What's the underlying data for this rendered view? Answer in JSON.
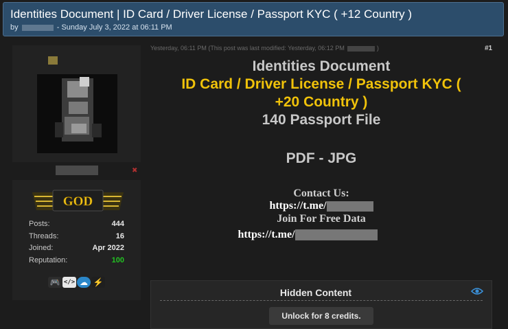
{
  "thread": {
    "title": "Identities Document | ID Card / Driver License / Passport KYC ( +12 Country )",
    "by_prefix": "by",
    "date_text": "- Sunday July 3, 2022 at 06:11 PM"
  },
  "author": {
    "rank_badge": "GOD",
    "stats": [
      {
        "label": "Posts:",
        "value": "444"
      },
      {
        "label": "Threads:",
        "value": "16"
      },
      {
        "label": "Joined:",
        "value": "Apr 2022"
      },
      {
        "label": "Reputation:",
        "value": "100",
        "color": "#22c322"
      }
    ],
    "award_icons": [
      "gamepad-icon",
      "code-icon",
      "cloud-icon",
      "lightning-icon"
    ]
  },
  "post": {
    "meta": "Yesterday, 06:11 PM  (This post was last modified: Yesterday, 06:12 PM",
    "meta_close": ")",
    "number": "#1",
    "lines": {
      "l1": "Identities Document",
      "l2": "ID Card / Driver License / Passport KYC (",
      "l3": "+20 Country )",
      "l4": "140 Passport File",
      "l5": "PDF - JPG",
      "contact": "Contact Us:",
      "link1": "https://t.me/",
      "join": "Join For Free Data",
      "link2": "https://t.me/"
    }
  },
  "hidden_content": {
    "title": "Hidden Content",
    "unlock_label": "Unlock for 8 credits."
  },
  "colors": {
    "accent_yellow": "#f0c20a",
    "header_bg": "#2c4d6b",
    "reputation_green": "#22c322"
  }
}
